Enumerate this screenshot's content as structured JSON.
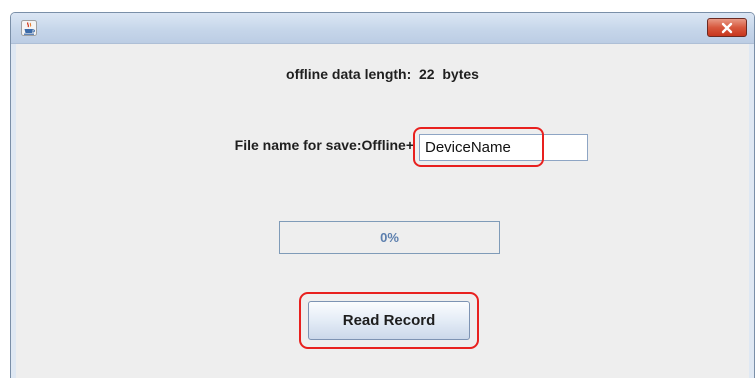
{
  "window": {
    "title": "",
    "app_icon": "java-cup-icon",
    "close_icon": "close-icon"
  },
  "content": {
    "offline_data_label": "offline data length:  22  bytes",
    "file_name_label": "File name for save:Offline+",
    "file_name_input": {
      "value": "DeviceName",
      "placeholder": ""
    },
    "progress": {
      "value_percent": 0,
      "text": "0%"
    },
    "read_record_button": "Read Record"
  },
  "colors": {
    "highlight": "#e8201e",
    "progress_text": "#5c7fae",
    "panel_background": "#eeeeee",
    "close_button": "#d7583e"
  }
}
